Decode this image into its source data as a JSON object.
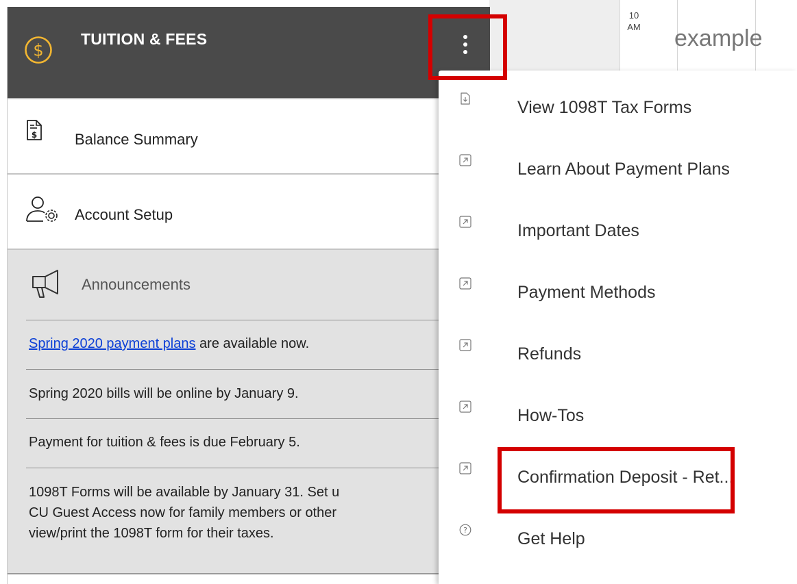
{
  "calendar": {
    "time_hour": "10",
    "time_period": "AM",
    "event_text": "example"
  },
  "widget": {
    "title": "TUITION & FEES",
    "header_icon": "dollar-circle-icon",
    "more_icon": "kebab-menu-icon",
    "rows": {
      "balance_summary": "Balance Summary",
      "account_setup": "Account Setup"
    },
    "announcements": {
      "title": "Announcements",
      "items": [
        {
          "link": "Spring 2020 payment plans",
          "text": " are available now."
        },
        {
          "text": "Spring 2020 bills will be online by January 9."
        },
        {
          "text": "Payment for tuition & fees is due February 5."
        },
        {
          "lines": [
            "1098T Forms will be available by January 31. Set u",
            "CU Guest Access now for family members or other",
            "view/print the 1098T form for their taxes."
          ]
        }
      ]
    }
  },
  "menu": {
    "items": [
      {
        "label": "View 1098T Tax Forms",
        "icon": "document-download-icon"
      },
      {
        "label": "Learn About Payment Plans",
        "icon": "external-link-icon"
      },
      {
        "label": "Important Dates",
        "icon": "external-link-icon"
      },
      {
        "label": "Payment Methods",
        "icon": "external-link-icon"
      },
      {
        "label": "Refunds",
        "icon": "external-link-icon"
      },
      {
        "label": "How-Tos",
        "icon": "external-link-icon"
      },
      {
        "label": "Confirmation Deposit - Ret...",
        "icon": "external-link-icon"
      },
      {
        "label": "Get Help",
        "icon": "help-circle-icon"
      }
    ]
  },
  "colors": {
    "header_bg": "#4a4a4a",
    "dollar_icon": "#f2b631",
    "highlight": "#d40000",
    "link": "#0b3fd6"
  }
}
